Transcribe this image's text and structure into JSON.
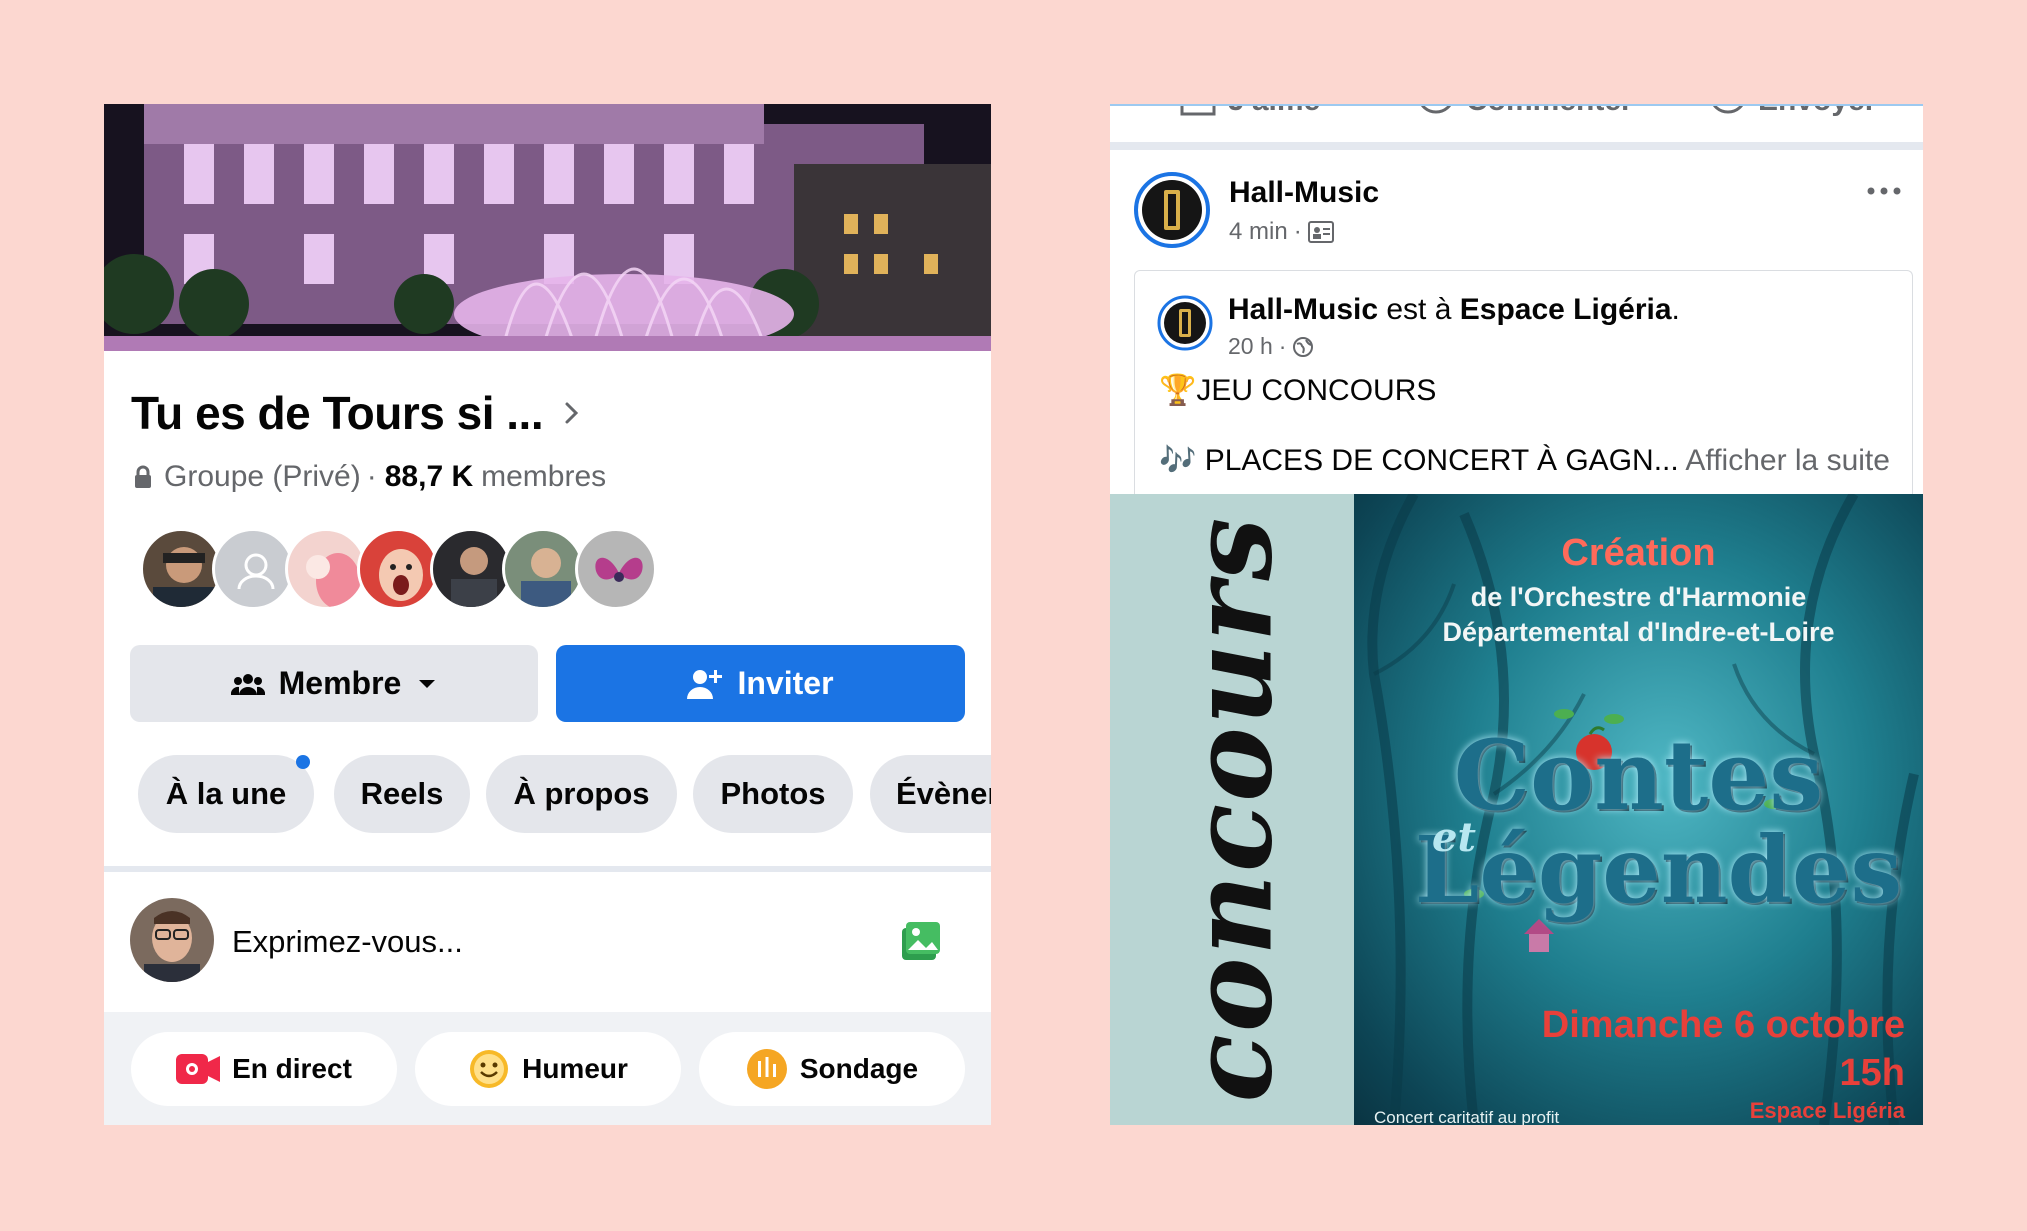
{
  "group": {
    "title": "Tu es de Tours si ...",
    "privacy": "Groupe (Privé)",
    "separator": "·",
    "member_count": "88,7 K",
    "member_word": "membres"
  },
  "buttons": {
    "member_label": "Membre",
    "invite_label": "Inviter"
  },
  "tabs": [
    "À la une",
    "Reels",
    "À propos",
    "Photos",
    "Évènements"
  ],
  "composer": {
    "placeholder": "Exprimez-vous..."
  },
  "actions": [
    "En direct",
    "Humeur",
    "Sondage"
  ],
  "previous_post_actions": [
    "J'aime",
    "Commenter",
    "Envoyer"
  ],
  "post": {
    "author": "Hall-Music",
    "time": "4 min",
    "separator": "·",
    "shared": {
      "author": "Hall-Music",
      "verb": " est à ",
      "place": "Espace Ligéria",
      "punct": ".",
      "time": "20 h",
      "line1": "🏆JEU CONCOURS",
      "line2": "🎶 PLACES DE CONCERT À GAGN...",
      "see_more": "Afficher la suite"
    }
  },
  "poster": {
    "side_word": "concours",
    "creation": "Création",
    "orchestra_line1": "de l'Orchestre d'Harmonie",
    "orchestra_line2": "Départemental d'Indre-et-Loire",
    "title_contes": "Contes",
    "title_et": "et",
    "title_legendes": "Légendes",
    "date": "Dimanche 6 octobre",
    "hour": "15h",
    "venue": "Espace Ligéria",
    "footer": "Concert caritatif au profit"
  },
  "colors": {
    "page_background": "#fcd7d0",
    "accent_blue": "#1b74e4",
    "chip_gray": "#e4e6eb",
    "live_red": "#f02849",
    "mood_yellow": "#f7b928",
    "poll_orange": "#f5a623",
    "photo_green": "#45bd62"
  }
}
